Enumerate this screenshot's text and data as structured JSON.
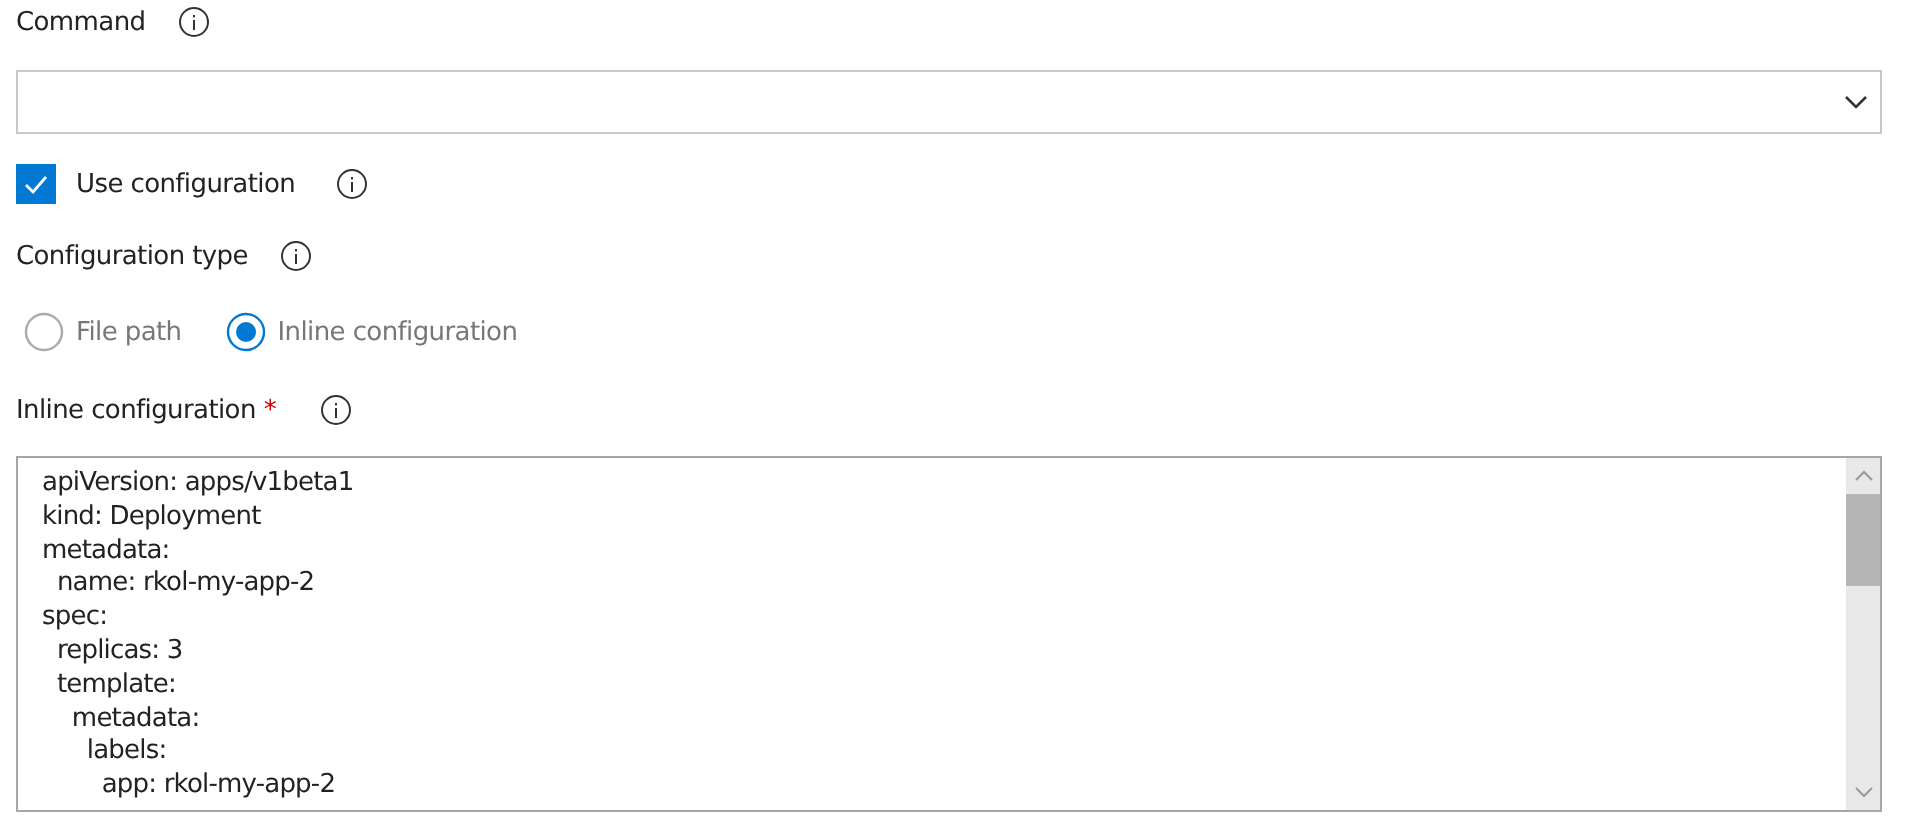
{
  "command": {
    "label": "Command"
  },
  "use_configuration": {
    "label": "Use configuration",
    "checked": true
  },
  "configuration_type": {
    "label": "Configuration type",
    "options": [
      {
        "label": "File path",
        "selected": false
      },
      {
        "label": "Inline configuration",
        "selected": true
      }
    ]
  },
  "inline_configuration": {
    "label": "Inline configuration",
    "required": true,
    "required_mark": "*",
    "value": "apiVersion: apps/v1beta1\nkind: Deployment\nmetadata:\n  name: rkol-my-app-2\nspec:\n  replicas: 3\n  template:\n    metadata:\n      labels:\n        app: rkol-my-app-2"
  }
}
